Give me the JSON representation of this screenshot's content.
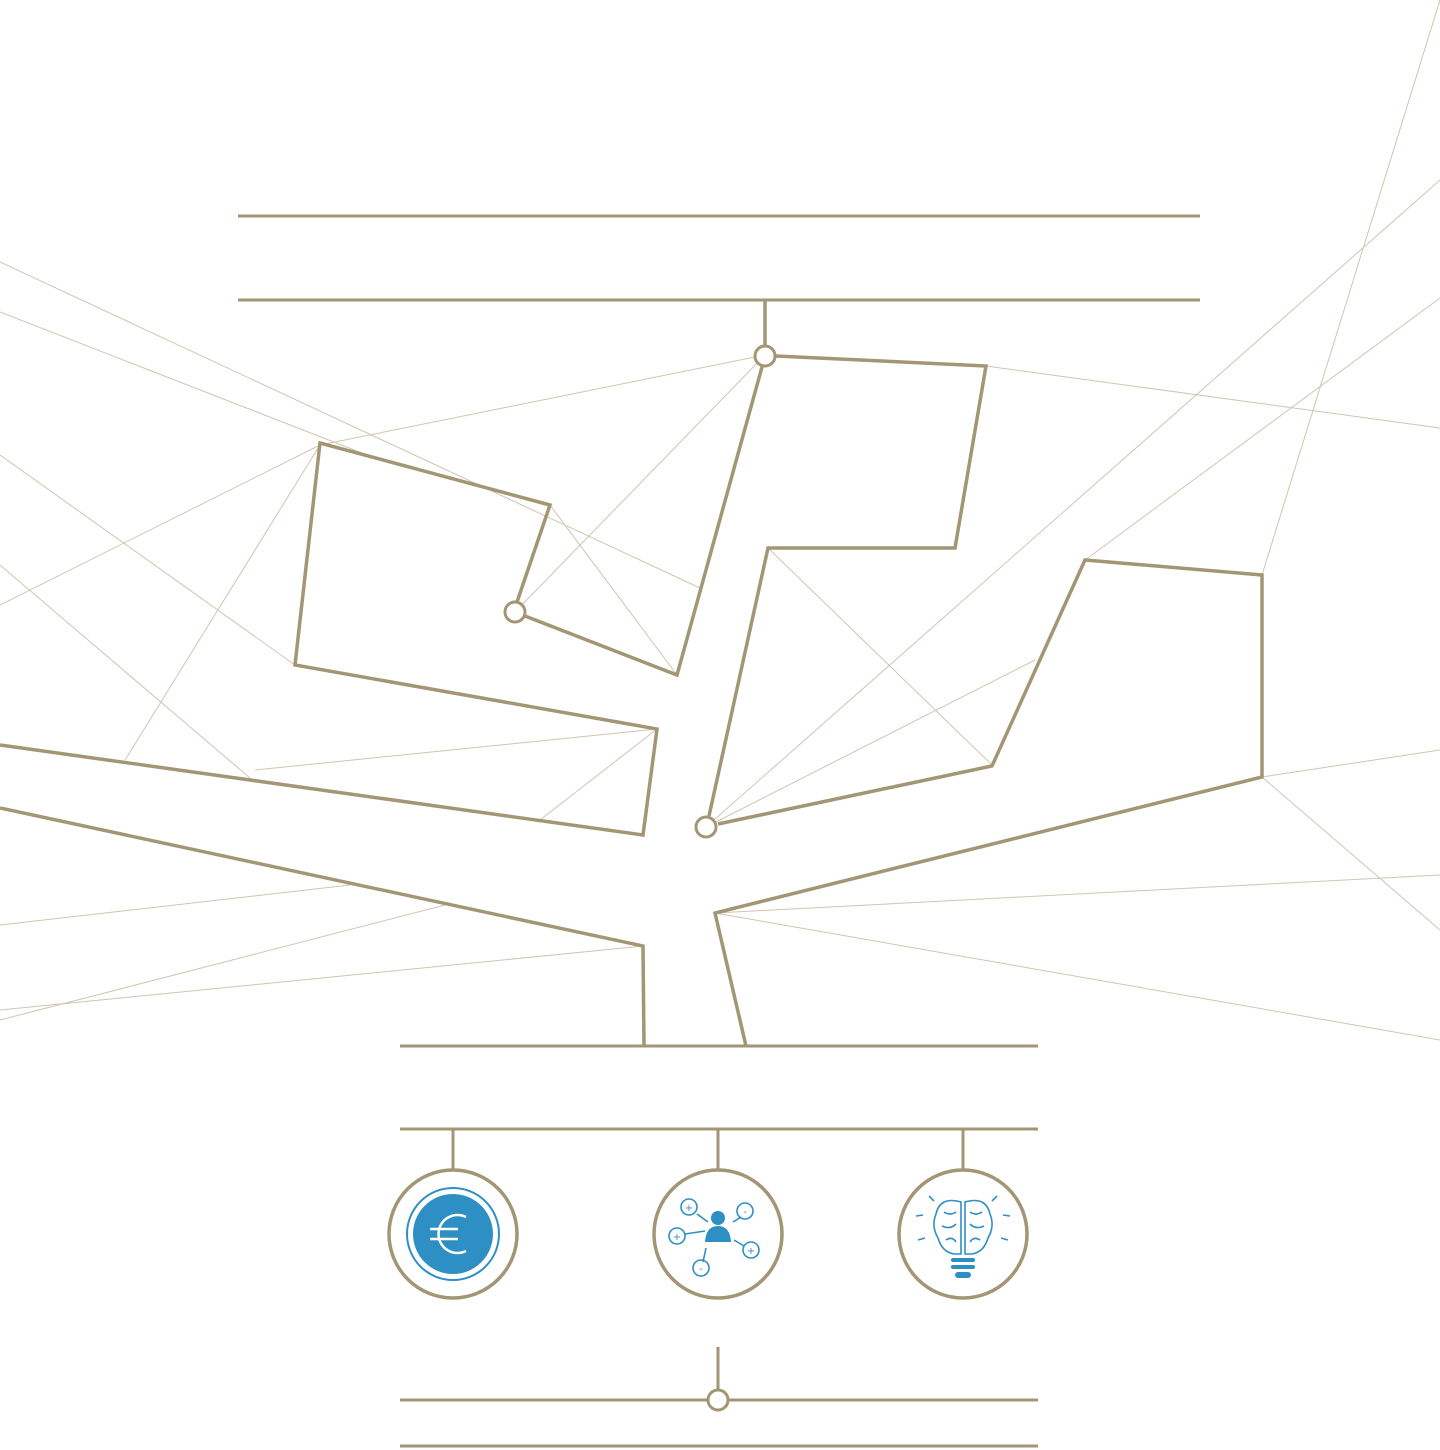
{
  "colors": {
    "background": "#ffffff",
    "structure": "#a39675",
    "thin_lines": "#cfc6b0",
    "icon_blue": "#2e8fc4"
  },
  "nodes": [
    {
      "id": "euro",
      "icon": "euro-icon"
    },
    {
      "id": "network",
      "icon": "person-network-icon"
    },
    {
      "id": "idea",
      "icon": "brain-lightbulb-icon"
    }
  ],
  "network_icon_signs": [
    "+",
    "-",
    "+",
    "+",
    "-"
  ]
}
